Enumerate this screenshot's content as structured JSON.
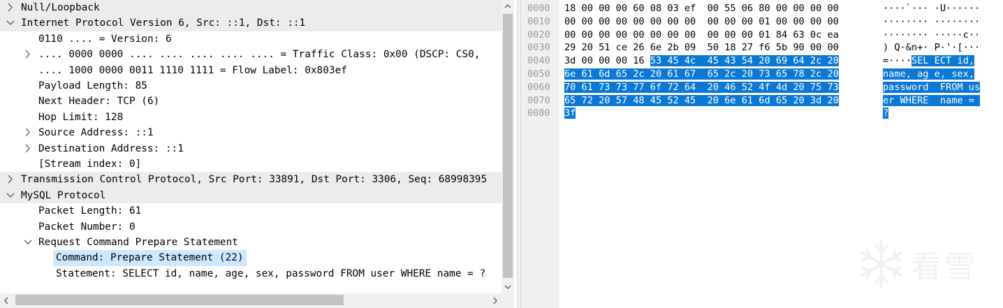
{
  "tree": {
    "rows": [
      {
        "text": "Null/Loopback",
        "toggle": "collapsed"
      },
      {
        "text": "Internet Protocol Version 6, Src: ::1, Dst: ::1",
        "toggle": "expanded"
      },
      {
        "text": "0110 .... = Version: 6",
        "toggle": "none"
      },
      {
        "text": ".... 0000 0000 .... .... .... .... .... = Traffic Class: 0x00 (DSCP: CS0,",
        "toggle": "collapsed"
      },
      {
        "text": ".... 1000 0000 0011 1110 1111 = Flow Label: 0x803ef",
        "toggle": "none"
      },
      {
        "text": "Payload Length: 85",
        "toggle": "none"
      },
      {
        "text": "Next Header: TCP (6)",
        "toggle": "none"
      },
      {
        "text": "Hop Limit: 128",
        "toggle": "none"
      },
      {
        "text": "Source Address: ::1",
        "toggle": "collapsed"
      },
      {
        "text": "Destination Address: ::1",
        "toggle": "collapsed"
      },
      {
        "text": "[Stream index: 0]",
        "toggle": "none"
      },
      {
        "text": "Transmission Control Protocol, Src Port: 33891, Dst Port: 3306, Seq: 68998395",
        "toggle": "collapsed"
      },
      {
        "text": "MySQL Protocol",
        "toggle": "expanded"
      },
      {
        "text": "Packet Length: 61",
        "toggle": "none"
      },
      {
        "text": "Packet Number: 0",
        "toggle": "none"
      },
      {
        "text": "Request Command Prepare Statement",
        "toggle": "expanded"
      },
      {
        "text": "Command: Prepare Statement (22)",
        "toggle": "none",
        "selected": true
      },
      {
        "text": "Statement: SELECT id, name, age, sex, password FROM user WHERE name = ?",
        "toggle": "none"
      }
    ]
  },
  "bytes": {
    "lines": [
      {
        "offset": "0000",
        "hex": [
          "18 00 00 00 60 08 03 ef  00 55 06 80 00 00 00 00",
          ""
        ],
        "ascii": [
          "····`··· ·U······",
          ""
        ]
      },
      {
        "offset": "0010",
        "hex": [
          "00 00 00 00 00 00 00 00  00 00 00 01 00 00 00 00",
          ""
        ],
        "ascii": [
          "········ ········",
          ""
        ]
      },
      {
        "offset": "0020",
        "hex": [
          "00 00 00 00 00 00 00 00  00 00 00 01 84 63 0c ea",
          ""
        ],
        "ascii": [
          "········ ·····c··",
          ""
        ]
      },
      {
        "offset": "0030",
        "hex": [
          "29 20 51 ce 26 6e 2b 09  50 18 27 f6 5b 90 00 00",
          ""
        ],
        "ascii": [
          ") Q·&n+· P·'·[···",
          ""
        ]
      },
      {
        "offset": "0040",
        "hex": [
          "3d 00 00 00 16 ",
          "53 45 4c  45 43 54 20 69 64 2c 20"
        ],
        "ascii": [
          "=····",
          "SEL ECT id,"
        ]
      },
      {
        "offset": "0050",
        "hex": [
          "",
          "6e 61 6d 65 2c 20 61 67  65 2c 20 73 65 78 2c 20"
        ],
        "ascii": [
          "",
          "name, ag e, sex,"
        ]
      },
      {
        "offset": "0060",
        "hex": [
          "",
          "70 61 73 73 77 6f 72 64  20 46 52 4f 4d 20 75 73"
        ],
        "ascii": [
          "",
          "password  FROM us"
        ]
      },
      {
        "offset": "0070",
        "hex": [
          "",
          "65 72 20 57 48 45 52 45  20 6e 61 6d 65 20 3d 20"
        ],
        "ascii": [
          "",
          "er WHERE  name = "
        ]
      },
      {
        "offset": "0080",
        "hex": [
          "",
          "3f"
        ],
        "ascii": [
          "",
          "?"
        ]
      }
    ]
  },
  "watermark": {
    "text": "看雪",
    "icon": "snowflake-icon"
  },
  "colors": {
    "selection": "#cce8ff",
    "byte_highlight": "#0a78d4",
    "band": "#ececec"
  }
}
